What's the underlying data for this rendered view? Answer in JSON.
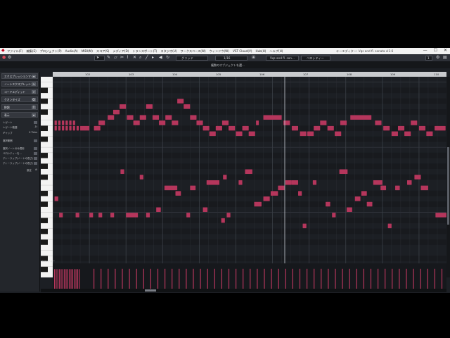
{
  "menubar": {
    "items": [
      "ファイル(F)",
      "編集(E)",
      "プロジェクト(P)",
      "Audio(A)",
      "MIDI(M)",
      "スコア(S)",
      "メディア(D)",
      "トランスポート(T)",
      "スタジオ(U)",
      "ワークスペース(W)",
      "ウィンドウ(W)",
      "VST Cloud(V)",
      "Hub(H)",
      "ヘルプ(H)"
    ],
    "window_title": "キーエディター: Vqs and fl. sonata vl1-6",
    "window_buttons": [
      "—",
      "☐",
      "✕"
    ]
  },
  "toolbar": {
    "snap_mode": "グリッド",
    "quantize": "1/16",
    "track_name": "Vqs and fl. son...",
    "color_mode": "ベロシティー",
    "zoom_value": "1",
    "icons": [
      "gear-icon",
      "arrow-tool-icon",
      "pencil-tool-icon",
      "eraser-tool-icon",
      "scissors-tool-icon",
      "glue-tool-icon",
      "mute-tool-icon",
      "zoom-tool-icon",
      "line-tool-icon",
      "speaker-icon",
      "snap-icon",
      "quantize-icon",
      "color-icon"
    ]
  },
  "status": {
    "text": "複数のオブジェクトを選..."
  },
  "left_panel": {
    "sections": [
      {
        "label": "エクスプレッションマップ",
        "icon": "list-icon"
      },
      {
        "label": "ノートエクスプレッション",
        "icon": "expression-icon"
      },
      {
        "label": "コードエディット",
        "icon": "chord-icon"
      },
      {
        "label": "クオンタイズ",
        "icon": "q-icon"
      },
      {
        "label": "移調",
        "icon": "transpose-icon"
      }
    ],
    "inspector_label": "表示",
    "settings": [
      {
        "label": "レガート",
        "value": ""
      },
      {
        "label": "レガート範囲",
        "value": "-1t"
      },
      {
        "label": "ギャップ",
        "value": "0 Ticks"
      },
      {
        "label": "選択範囲",
        "value": ""
      },
      {
        "label": "選択ノートのみ適用",
        "value": ""
      },
      {
        "label": "ベロシティーを...",
        "value": ""
      },
      {
        "label": "ディーラップ(ノートの長さ)",
        "value": ""
      },
      {
        "label": "ディーラップ(ノートの長さ)",
        "value": ""
      }
    ],
    "footer": "設定"
  },
  "ruler": {
    "bars": [
      "102",
      "103",
      "104",
      "105",
      "106",
      "107",
      "108",
      "109",
      "110",
      "111"
    ]
  },
  "velocity_label": "ベロシティー",
  "colors": {
    "note": "#b5365c",
    "background": "#1c1f24",
    "grid": "#2c3036",
    "playhead": "#c8ccd2",
    "velocity": "#b5365c"
  },
  "note_data": {
    "range_pitch": [
      48,
      84
    ],
    "range_beats": [
      0,
      43
    ],
    "notes": [
      {
        "start": 0.2,
        "len": 0.25,
        "pitch": 76
      },
      {
        "start": 0.6,
        "len": 0.25,
        "pitch": 76
      },
      {
        "start": 1.0,
        "len": 0.25,
        "pitch": 76
      },
      {
        "start": 1.4,
        "len": 0.25,
        "pitch": 76
      },
      {
        "start": 1.8,
        "len": 0.25,
        "pitch": 76
      },
      {
        "start": 2.2,
        "len": 0.25,
        "pitch": 76
      },
      {
        "start": 0.2,
        "len": 0.25,
        "pitch": 75
      },
      {
        "start": 0.6,
        "len": 0.25,
        "pitch": 75
      },
      {
        "start": 1.0,
        "len": 0.25,
        "pitch": 75
      },
      {
        "start": 1.4,
        "len": 0.25,
        "pitch": 75
      },
      {
        "start": 1.8,
        "len": 0.25,
        "pitch": 75
      },
      {
        "start": 2.2,
        "len": 0.25,
        "pitch": 75
      },
      {
        "start": 2.6,
        "len": 0.25,
        "pitch": 75
      },
      {
        "start": 3.0,
        "len": 1.0,
        "pitch": 75
      },
      {
        "start": 4.5,
        "len": 0.7,
        "pitch": 75
      },
      {
        "start": 5.0,
        "len": 0.7,
        "pitch": 76
      },
      {
        "start": 6.0,
        "len": 0.7,
        "pitch": 77
      },
      {
        "start": 6.6,
        "len": 0.7,
        "pitch": 78
      },
      {
        "start": 7.3,
        "len": 0.7,
        "pitch": 79
      },
      {
        "start": 8.1,
        "len": 0.7,
        "pitch": 77
      },
      {
        "start": 8.8,
        "len": 0.7,
        "pitch": 76
      },
      {
        "start": 9.5,
        "len": 0.7,
        "pitch": 77
      },
      {
        "start": 10.2,
        "len": 0.7,
        "pitch": 79
      },
      {
        "start": 10.9,
        "len": 0.7,
        "pitch": 77
      },
      {
        "start": 11.6,
        "len": 0.7,
        "pitch": 76
      },
      {
        "start": 12.3,
        "len": 0.7,
        "pitch": 77
      },
      {
        "start": 13.0,
        "len": 0.7,
        "pitch": 76
      },
      {
        "start": 13.6,
        "len": 0.7,
        "pitch": 80
      },
      {
        "start": 14.3,
        "len": 0.7,
        "pitch": 79
      },
      {
        "start": 15.0,
        "len": 0.7,
        "pitch": 77
      },
      {
        "start": 15.7,
        "len": 0.7,
        "pitch": 76
      },
      {
        "start": 16.4,
        "len": 0.7,
        "pitch": 75
      },
      {
        "start": 17.1,
        "len": 0.7,
        "pitch": 74
      },
      {
        "start": 17.8,
        "len": 0.7,
        "pitch": 75
      },
      {
        "start": 18.5,
        "len": 0.7,
        "pitch": 76
      },
      {
        "start": 19.2,
        "len": 0.7,
        "pitch": 75
      },
      {
        "start": 20.0,
        "len": 0.7,
        "pitch": 74
      },
      {
        "start": 20.7,
        "len": 0.7,
        "pitch": 75
      },
      {
        "start": 21.4,
        "len": 0.7,
        "pitch": 74
      },
      {
        "start": 22.2,
        "len": 0.3,
        "pitch": 76
      },
      {
        "start": 23.0,
        "len": 2.0,
        "pitch": 77
      },
      {
        "start": 25.2,
        "len": 0.7,
        "pitch": 76
      },
      {
        "start": 26.1,
        "len": 0.7,
        "pitch": 75
      },
      {
        "start": 27.0,
        "len": 0.7,
        "pitch": 74
      },
      {
        "start": 27.8,
        "len": 0.7,
        "pitch": 74
      },
      {
        "start": 28.5,
        "len": 0.7,
        "pitch": 75
      },
      {
        "start": 29.2,
        "len": 0.7,
        "pitch": 76
      },
      {
        "start": 30.0,
        "len": 0.7,
        "pitch": 75
      },
      {
        "start": 30.8,
        "len": 0.7,
        "pitch": 74
      },
      {
        "start": 31.4,
        "len": 0.7,
        "pitch": 76
      },
      {
        "start": 32.5,
        "len": 2.3,
        "pitch": 77
      },
      {
        "start": 35.2,
        "len": 0.7,
        "pitch": 76
      },
      {
        "start": 36.1,
        "len": 0.7,
        "pitch": 75
      },
      {
        "start": 37.0,
        "len": 0.7,
        "pitch": 74
      },
      {
        "start": 37.7,
        "len": 0.7,
        "pitch": 75
      },
      {
        "start": 38.4,
        "len": 0.7,
        "pitch": 74
      },
      {
        "start": 39.1,
        "len": 0.7,
        "pitch": 76
      },
      {
        "start": 40.0,
        "len": 0.7,
        "pitch": 75
      },
      {
        "start": 40.8,
        "len": 0.7,
        "pitch": 74
      },
      {
        "start": 41.7,
        "len": 1.2,
        "pitch": 75
      },
      {
        "start": 7.4,
        "len": 0.4,
        "pitch": 67
      },
      {
        "start": 9.5,
        "len": 0.4,
        "pitch": 66
      },
      {
        "start": 12.2,
        "len": 1.4,
        "pitch": 64
      },
      {
        "start": 13.4,
        "len": 0.6,
        "pitch": 63
      },
      {
        "start": 15.0,
        "len": 0.6,
        "pitch": 64
      },
      {
        "start": 16.8,
        "len": 1.4,
        "pitch": 65
      },
      {
        "start": 18.6,
        "len": 0.4,
        "pitch": 66
      },
      {
        "start": 19.0,
        "len": 0.4,
        "pitch": 59
      },
      {
        "start": 20.3,
        "len": 0.4,
        "pitch": 65
      },
      {
        "start": 21.0,
        "len": 0.8,
        "pitch": 67
      },
      {
        "start": 22.0,
        "len": 0.8,
        "pitch": 61
      },
      {
        "start": 23.0,
        "len": 0.7,
        "pitch": 62
      },
      {
        "start": 23.8,
        "len": 0.8,
        "pitch": 63
      },
      {
        "start": 24.6,
        "len": 0.7,
        "pitch": 64
      },
      {
        "start": 25.4,
        "len": 0.7,
        "pitch": 65
      },
      {
        "start": 26.1,
        "len": 0.7,
        "pitch": 65
      },
      {
        "start": 26.8,
        "len": 0.4,
        "pitch": 63
      },
      {
        "start": 27.3,
        "len": 0.4,
        "pitch": 57
      },
      {
        "start": 28.4,
        "len": 0.4,
        "pitch": 65
      },
      {
        "start": 29.8,
        "len": 0.5,
        "pitch": 61
      },
      {
        "start": 30.5,
        "len": 0.4,
        "pitch": 59
      },
      {
        "start": 31.3,
        "len": 0.9,
        "pitch": 67
      },
      {
        "start": 32.1,
        "len": 0.6,
        "pitch": 60
      },
      {
        "start": 33.0,
        "len": 0.6,
        "pitch": 62
      },
      {
        "start": 33.7,
        "len": 0.6,
        "pitch": 63
      },
      {
        "start": 34.3,
        "len": 0.6,
        "pitch": 61
      },
      {
        "start": 35.0,
        "len": 1.0,
        "pitch": 65
      },
      {
        "start": 35.8,
        "len": 0.6,
        "pitch": 64
      },
      {
        "start": 36.6,
        "len": 0.4,
        "pitch": 57
      },
      {
        "start": 37.4,
        "len": 0.5,
        "pitch": 64
      },
      {
        "start": 38.7,
        "len": 0.5,
        "pitch": 65
      },
      {
        "start": 39.5,
        "len": 0.7,
        "pitch": 66
      },
      {
        "start": 40.2,
        "len": 0.8,
        "pitch": 64
      },
      {
        "start": 41.8,
        "len": 1.2,
        "pitch": 59
      },
      {
        "start": 0.2,
        "len": 0.4,
        "pitch": 62
      },
      {
        "start": 0.7,
        "len": 0.4,
        "pitch": 59
      },
      {
        "start": 2.5,
        "len": 0.4,
        "pitch": 59
      },
      {
        "start": 4.0,
        "len": 0.4,
        "pitch": 59
      },
      {
        "start": 5.0,
        "len": 0.4,
        "pitch": 59
      },
      {
        "start": 6.3,
        "len": 0.4,
        "pitch": 59
      },
      {
        "start": 8.0,
        "len": 1.3,
        "pitch": 59
      },
      {
        "start": 10.2,
        "len": 0.4,
        "pitch": 59
      },
      {
        "start": 11.3,
        "len": 0.5,
        "pitch": 60
      },
      {
        "start": 14.6,
        "len": 0.4,
        "pitch": 59
      },
      {
        "start": 16.4,
        "len": 0.5,
        "pitch": 60
      },
      {
        "start": 18.4,
        "len": 0.4,
        "pitch": 58
      }
    ]
  },
  "velocity_data": {
    "range": [
      0,
      127
    ],
    "values": [
      110,
      110,
      110,
      110,
      110,
      110,
      110,
      110,
      110,
      110,
      110,
      110,
      110,
      110,
      110,
      110,
      112,
      112,
      112,
      112,
      112,
      112,
      112,
      112,
      112,
      112,
      112,
      112,
      112,
      112,
      112,
      112,
      112,
      112,
      112,
      112,
      112,
      112,
      112,
      112,
      112,
      112,
      112,
      112,
      112,
      112,
      112,
      112,
      112,
      112,
      112,
      112,
      112,
      112,
      112,
      112,
      112,
      112,
      112,
      112,
      112,
      112,
      112,
      112,
      112,
      112
    ]
  }
}
